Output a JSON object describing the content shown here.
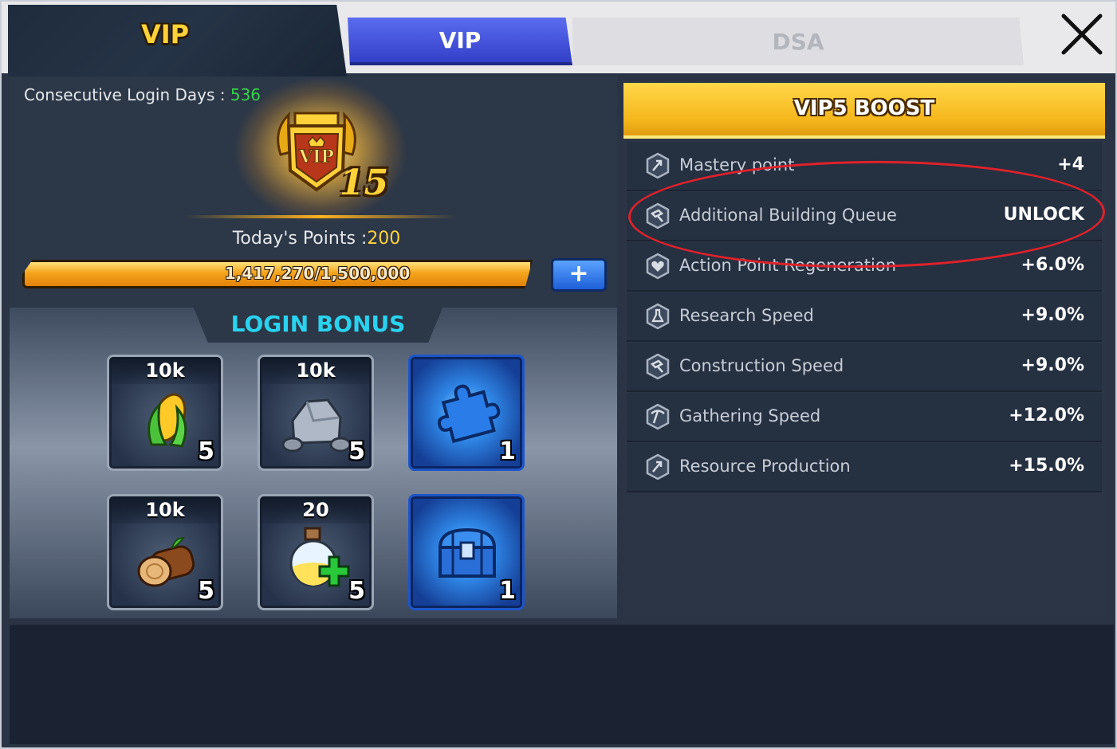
{
  "header": {
    "title": "VIP",
    "tabs": [
      {
        "label": "VIP",
        "active": true
      },
      {
        "label": "DSA",
        "active": false
      }
    ],
    "close_icon": "close-icon"
  },
  "status": {
    "login_days_label": "Consecutive Login Days :",
    "login_days_value": "536",
    "vip_level": "15",
    "vip_badge_text": "VIP",
    "today_points_label": "Today's Points :",
    "today_points_value": "200",
    "progress_text": "1,417,270/1,500,000",
    "progress_fraction": 0.945,
    "plus_label": "+"
  },
  "login_bonus": {
    "title": "LOGIN BONUS",
    "items": [
      {
        "amount": "10k",
        "count": "5",
        "icon": "corn-icon"
      },
      {
        "amount": "10k",
        "count": "5",
        "icon": "stone-icon"
      },
      {
        "amount": "",
        "count": "1",
        "icon": "puzzle-piece-icon"
      },
      {
        "amount": "10k",
        "count": "5",
        "icon": "wood-log-icon"
      },
      {
        "amount": "20",
        "count": "5",
        "icon": "potion-icon"
      },
      {
        "amount": "",
        "count": "1",
        "icon": "treasure-chest-icon"
      }
    ]
  },
  "boost": {
    "title": "VIP5 BOOST",
    "rows": [
      {
        "label": "Mastery point",
        "value": "+4"
      },
      {
        "label": "Additional Building Queue",
        "value": "UNLOCK"
      },
      {
        "label": "Action Point Regeneration",
        "value": "+6.0%"
      },
      {
        "label": "Research Speed",
        "value": "+9.0%"
      },
      {
        "label": "Construction Speed",
        "value": "+9.0%"
      },
      {
        "label": "Gathering Speed",
        "value": "+12.0%"
      },
      {
        "label": "Resource Production",
        "value": "+15.0%"
      }
    ]
  },
  "colors": {
    "accent_gold": "#ffd23a",
    "green": "#36d24a",
    "cyan": "#29d3ef",
    "tab_blue": "#3340c8",
    "highlight_red": "#e0212a"
  }
}
